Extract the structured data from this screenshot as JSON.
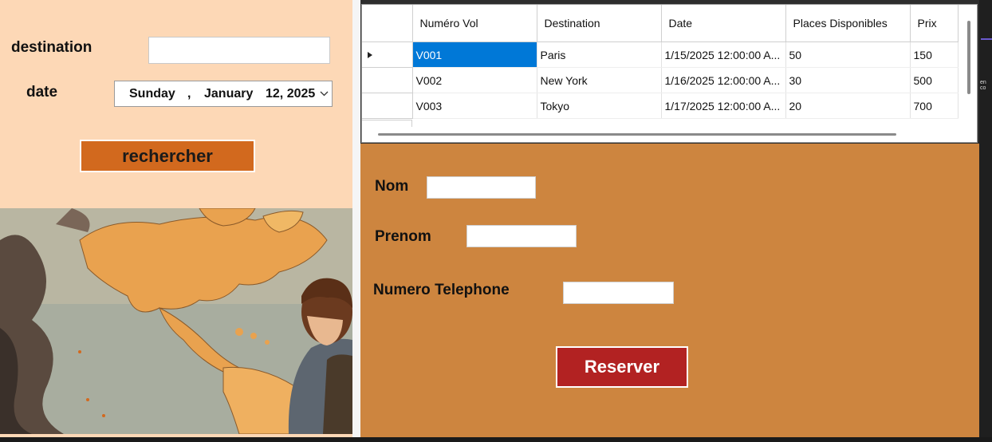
{
  "search": {
    "destination_label": "destination",
    "destination_value": "",
    "date_label": "date",
    "date_weekday": "Sunday",
    "date_sep": ",",
    "date_month": "January",
    "date_day_year": "12, 2025",
    "search_button": "rechercher"
  },
  "grid": {
    "columns": [
      "Numéro Vol",
      "Destination",
      "Date",
      "Places Disponibles",
      "Prix"
    ],
    "rows": [
      {
        "numero": "V001",
        "destination": "Paris",
        "date": "1/15/2025 12:00:00 A...",
        "places": "50",
        "prix": "150"
      },
      {
        "numero": "V002",
        "destination": "New York",
        "date": "1/16/2025 12:00:00 A...",
        "places": "30",
        "prix": "500"
      },
      {
        "numero": "V003",
        "destination": "Tokyo",
        "date": "1/17/2025 12:00:00 A...",
        "places": "20",
        "prix": "700"
      }
    ],
    "selected_row": 0
  },
  "reservation": {
    "nom_label": "Nom",
    "prenom_label": "Prenom",
    "telephone_label": "Numero Telephone",
    "nom_value": "",
    "prenom_value": "",
    "telephone_value": "",
    "reserve_button": "Reserver"
  },
  "side": {
    "clipped_text": "en co"
  },
  "colors": {
    "left_bg": "#fdd8b6",
    "right_bg": "#cd853f",
    "search_button": "#d2691e",
    "reserve_button": "#b22222",
    "selection": "#0078d7"
  },
  "icons": {
    "row_pointer": "row-pointer-icon",
    "dropdown": "chevron-down-icon"
  }
}
